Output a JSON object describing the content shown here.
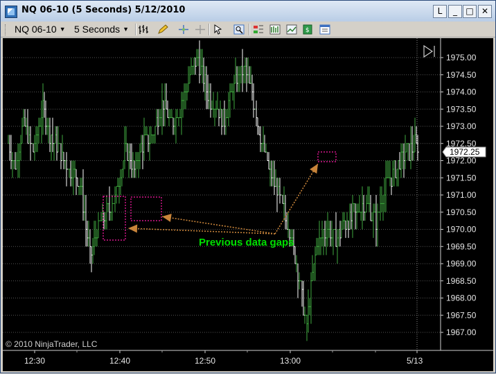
{
  "window": {
    "title": "NQ 06-10 (5 Seconds)  5/12/2010",
    "buttons": [
      "L",
      "_",
      "□",
      "✕"
    ]
  },
  "toolbar": {
    "instrument": "NQ 06-10",
    "interval": "5 Seconds",
    "icons": [
      "bar-type-icon",
      "pencil-draw-icon",
      "crosshair-icon",
      "global-crosshair-icon",
      "pointer-icon",
      "zoom-icon",
      "chart-trader-icon",
      "indicators-icon",
      "strategies-icon",
      "data-series-icon",
      "properties-icon"
    ]
  },
  "chart": {
    "copyright": "© 2010 NinjaTrader, LLC",
    "annotation": "Previous data gaps",
    "last_price_label": "1972.25",
    "colors": {
      "up": "#3faa3f",
      "down": "#ffffff",
      "annotation_text": "#00e000",
      "arrow": "#c8843a",
      "gap_box": "#ff1aa8",
      "grid": "#555555"
    }
  },
  "chart_data": {
    "type": "line",
    "title": "NQ 06-10 (5 Seconds)",
    "xlabel": "",
    "ylabel": "",
    "y_ticks": [
      "1975.00",
      "1974.50",
      "1974.00",
      "1973.50",
      "1973.00",
      "1972.50",
      "1972.00",
      "1971.50",
      "1971.00",
      "1970.50",
      "1970.00",
      "1969.50",
      "1969.00",
      "1968.50",
      "1968.00",
      "1967.50",
      "1967.00"
    ],
    "x_ticks": [
      "12:30",
      "12:40",
      "12:50",
      "13:00",
      "5/13"
    ],
    "ylim": [
      1966.75,
      1975.5
    ],
    "series": [
      {
        "x": [
          0,
          3,
          6,
          10,
          14,
          17,
          21,
          25,
          29,
          33,
          36,
          40,
          43,
          47,
          51,
          54,
          58,
          62,
          65,
          69,
          73,
          76,
          80,
          84,
          87,
          91,
          95,
          98,
          102,
          106,
          110,
          114,
          117,
          120
        ],
        "values": [
          1972.5,
          1971.75,
          1973.0,
          1972.25,
          1973.5,
          1972.75,
          1972.25,
          1971.75,
          1971.25,
          1969.25,
          1970.0,
          1970.5,
          1971.0,
          1972.25,
          1971.75,
          1972.5,
          1972.75,
          1973.75,
          1973.0,
          1973.5,
          1974.5,
          1975.0,
          1974.0,
          1973.5,
          1973.25,
          1974.25,
          1974.75,
          1974.0,
          1972.5,
          1971.5,
          1970.75,
          1969.75,
          1968.5,
          1967.25
        ]
      },
      {
        "x": [
          120,
          124,
          128,
          132,
          136,
          140,
          144,
          148,
          152,
          156,
          160,
          165
        ],
        "values": [
          1967.25,
          1969.5,
          1970.0,
          1969.75,
          1970.25,
          1970.5,
          1970.75,
          1970.25,
          1971.25,
          1971.75,
          1972.25,
          1972.5
        ]
      }
    ]
  }
}
